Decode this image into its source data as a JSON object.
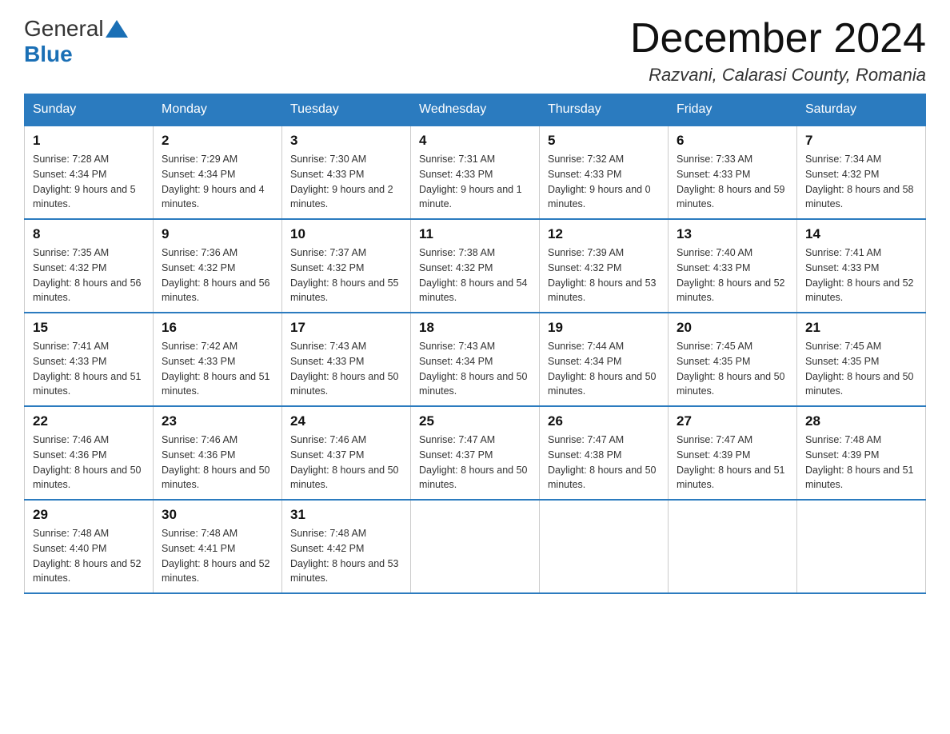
{
  "header": {
    "logo_general": "General",
    "logo_blue": "Blue",
    "month_title": "December 2024",
    "location": "Razvani, Calarasi County, Romania"
  },
  "days_of_week": [
    "Sunday",
    "Monday",
    "Tuesday",
    "Wednesday",
    "Thursday",
    "Friday",
    "Saturday"
  ],
  "weeks": [
    [
      {
        "day": "1",
        "sunrise": "7:28 AM",
        "sunset": "4:34 PM",
        "daylight": "9 hours and 5 minutes."
      },
      {
        "day": "2",
        "sunrise": "7:29 AM",
        "sunset": "4:34 PM",
        "daylight": "9 hours and 4 minutes."
      },
      {
        "day": "3",
        "sunrise": "7:30 AM",
        "sunset": "4:33 PM",
        "daylight": "9 hours and 2 minutes."
      },
      {
        "day": "4",
        "sunrise": "7:31 AM",
        "sunset": "4:33 PM",
        "daylight": "9 hours and 1 minute."
      },
      {
        "day": "5",
        "sunrise": "7:32 AM",
        "sunset": "4:33 PM",
        "daylight": "9 hours and 0 minutes."
      },
      {
        "day": "6",
        "sunrise": "7:33 AM",
        "sunset": "4:33 PM",
        "daylight": "8 hours and 59 minutes."
      },
      {
        "day": "7",
        "sunrise": "7:34 AM",
        "sunset": "4:32 PM",
        "daylight": "8 hours and 58 minutes."
      }
    ],
    [
      {
        "day": "8",
        "sunrise": "7:35 AM",
        "sunset": "4:32 PM",
        "daylight": "8 hours and 56 minutes."
      },
      {
        "day": "9",
        "sunrise": "7:36 AM",
        "sunset": "4:32 PM",
        "daylight": "8 hours and 56 minutes."
      },
      {
        "day": "10",
        "sunrise": "7:37 AM",
        "sunset": "4:32 PM",
        "daylight": "8 hours and 55 minutes."
      },
      {
        "day": "11",
        "sunrise": "7:38 AM",
        "sunset": "4:32 PM",
        "daylight": "8 hours and 54 minutes."
      },
      {
        "day": "12",
        "sunrise": "7:39 AM",
        "sunset": "4:32 PM",
        "daylight": "8 hours and 53 minutes."
      },
      {
        "day": "13",
        "sunrise": "7:40 AM",
        "sunset": "4:33 PM",
        "daylight": "8 hours and 52 minutes."
      },
      {
        "day": "14",
        "sunrise": "7:41 AM",
        "sunset": "4:33 PM",
        "daylight": "8 hours and 52 minutes."
      }
    ],
    [
      {
        "day": "15",
        "sunrise": "7:41 AM",
        "sunset": "4:33 PM",
        "daylight": "8 hours and 51 minutes."
      },
      {
        "day": "16",
        "sunrise": "7:42 AM",
        "sunset": "4:33 PM",
        "daylight": "8 hours and 51 minutes."
      },
      {
        "day": "17",
        "sunrise": "7:43 AM",
        "sunset": "4:33 PM",
        "daylight": "8 hours and 50 minutes."
      },
      {
        "day": "18",
        "sunrise": "7:43 AM",
        "sunset": "4:34 PM",
        "daylight": "8 hours and 50 minutes."
      },
      {
        "day": "19",
        "sunrise": "7:44 AM",
        "sunset": "4:34 PM",
        "daylight": "8 hours and 50 minutes."
      },
      {
        "day": "20",
        "sunrise": "7:45 AM",
        "sunset": "4:35 PM",
        "daylight": "8 hours and 50 minutes."
      },
      {
        "day": "21",
        "sunrise": "7:45 AM",
        "sunset": "4:35 PM",
        "daylight": "8 hours and 50 minutes."
      }
    ],
    [
      {
        "day": "22",
        "sunrise": "7:46 AM",
        "sunset": "4:36 PM",
        "daylight": "8 hours and 50 minutes."
      },
      {
        "day": "23",
        "sunrise": "7:46 AM",
        "sunset": "4:36 PM",
        "daylight": "8 hours and 50 minutes."
      },
      {
        "day": "24",
        "sunrise": "7:46 AM",
        "sunset": "4:37 PM",
        "daylight": "8 hours and 50 minutes."
      },
      {
        "day": "25",
        "sunrise": "7:47 AM",
        "sunset": "4:37 PM",
        "daylight": "8 hours and 50 minutes."
      },
      {
        "day": "26",
        "sunrise": "7:47 AM",
        "sunset": "4:38 PM",
        "daylight": "8 hours and 50 minutes."
      },
      {
        "day": "27",
        "sunrise": "7:47 AM",
        "sunset": "4:39 PM",
        "daylight": "8 hours and 51 minutes."
      },
      {
        "day": "28",
        "sunrise": "7:48 AM",
        "sunset": "4:39 PM",
        "daylight": "8 hours and 51 minutes."
      }
    ],
    [
      {
        "day": "29",
        "sunrise": "7:48 AM",
        "sunset": "4:40 PM",
        "daylight": "8 hours and 52 minutes."
      },
      {
        "day": "30",
        "sunrise": "7:48 AM",
        "sunset": "4:41 PM",
        "daylight": "8 hours and 52 minutes."
      },
      {
        "day": "31",
        "sunrise": "7:48 AM",
        "sunset": "4:42 PM",
        "daylight": "8 hours and 53 minutes."
      },
      null,
      null,
      null,
      null
    ]
  ]
}
